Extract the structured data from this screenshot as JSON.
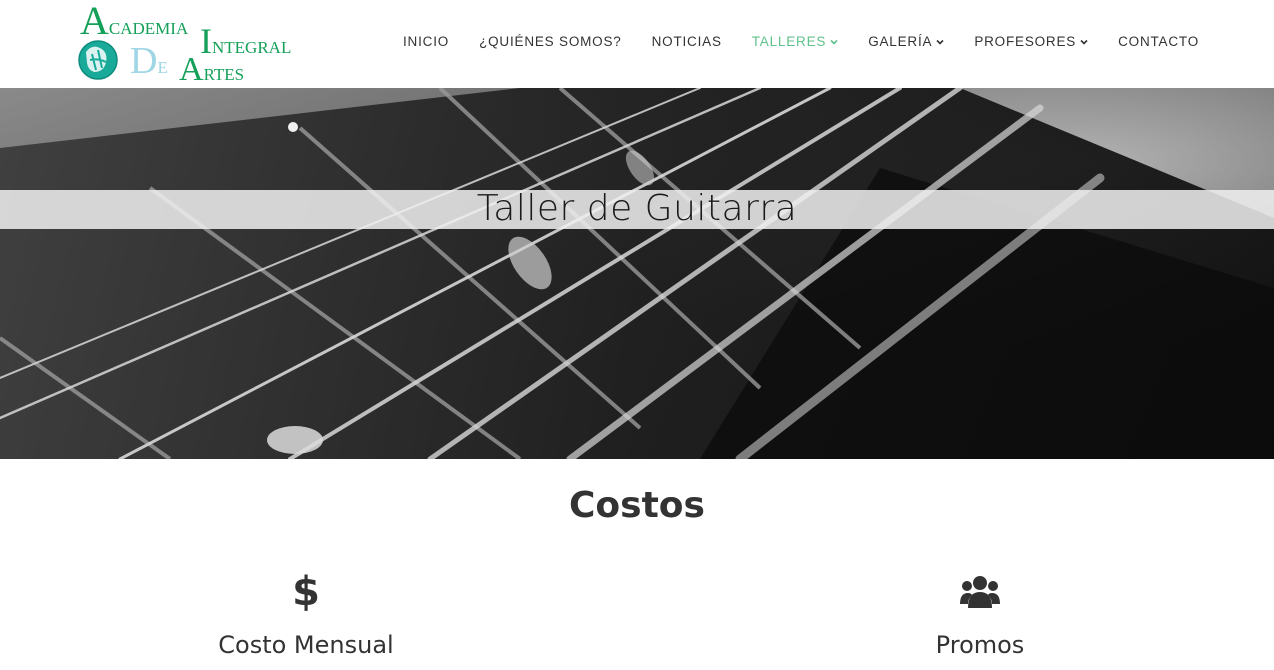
{
  "logo": {
    "line1_cap": "A",
    "line1_rest": "CADEMIA",
    "line2_cap": "I",
    "line2_rest": "NTEGRAL",
    "line3_cap_d": "D",
    "line3_e": "E",
    "line3_cap_a": "A",
    "line3_rest": "RTES",
    "colors": {
      "green": "#15a05a",
      "teal": "#1aaa9a",
      "light_blue": "#9fd6e6"
    }
  },
  "nav": {
    "items": [
      {
        "label": "INICIO",
        "dropdown": false,
        "active": false
      },
      {
        "label": "¿QUIÉNES SOMOS?",
        "dropdown": false,
        "active": false
      },
      {
        "label": "NOTICIAS",
        "dropdown": false,
        "active": false
      },
      {
        "label": "TALLERES",
        "dropdown": true,
        "active": true
      },
      {
        "label": "GALERÍA",
        "dropdown": true,
        "active": false
      },
      {
        "label": "PROFESORES",
        "dropdown": true,
        "active": false
      },
      {
        "label": "CONTACTO",
        "dropdown": false,
        "active": false
      }
    ],
    "active_color": "#5fc18b"
  },
  "hero": {
    "title": "Taller de Guitarra",
    "image": "guitar-fretboard-strings-grayscale"
  },
  "costs": {
    "title": "Costos",
    "features": [
      {
        "icon": "dollar-icon",
        "label": "Costo Mensual"
      },
      {
        "icon": "users-icon",
        "label": "Promos"
      }
    ]
  }
}
